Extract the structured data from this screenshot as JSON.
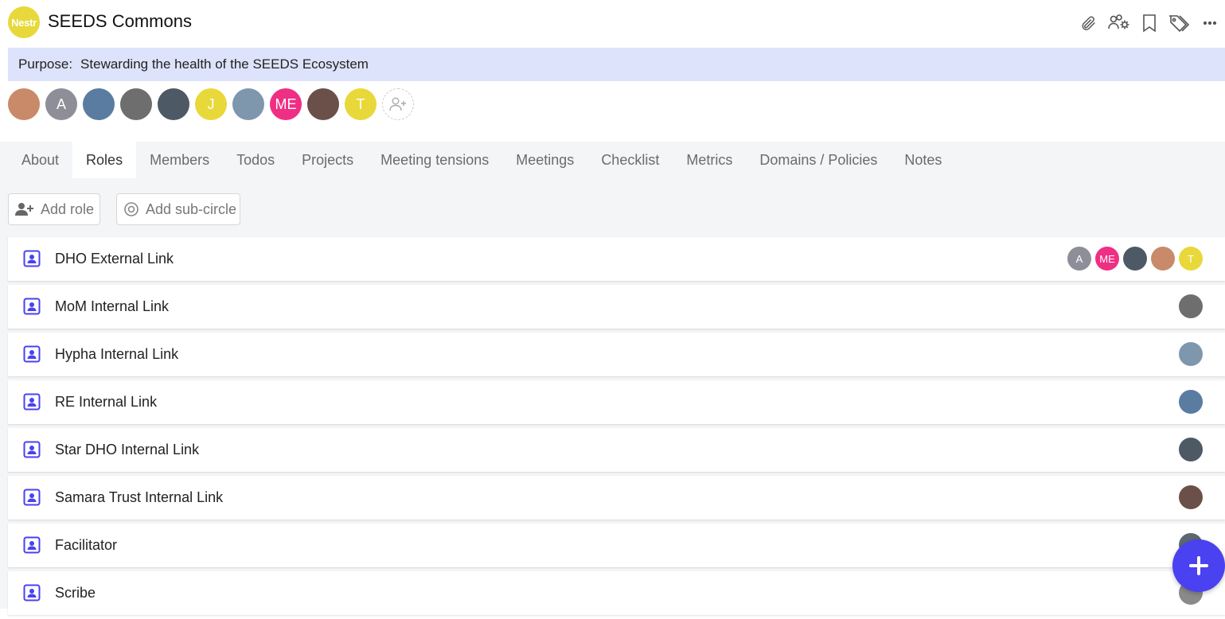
{
  "header": {
    "logo_text": "Nestr",
    "title": "SEEDS Commons"
  },
  "header_icons": [
    "paperclip-icon",
    "team-settings-icon",
    "bookmark-icon",
    "tags-icon",
    "more-icon"
  ],
  "purpose": {
    "label": "Purpose:",
    "text": "Stewarding the health of the SEEDS Ecosystem"
  },
  "members": [
    {
      "initial": "",
      "color": "#c98a6a"
    },
    {
      "initial": "A",
      "color": "#8e8e99"
    },
    {
      "initial": "",
      "color": "#5a7ca0"
    },
    {
      "initial": "",
      "color": "#6e6e6e"
    },
    {
      "initial": "",
      "color": "#4e5966"
    },
    {
      "initial": "J",
      "color": "#e8d83a"
    },
    {
      "initial": "",
      "color": "#7f97ad"
    },
    {
      "initial": "ME",
      "color": "#ef2f84"
    },
    {
      "initial": "",
      "color": "#6a5048"
    },
    {
      "initial": "T",
      "color": "#e8d83a"
    }
  ],
  "tabs": [
    "About",
    "Roles",
    "Members",
    "Todos",
    "Projects",
    "Meeting tensions",
    "Meetings",
    "Checklist",
    "Metrics",
    "Domains / Policies",
    "Notes"
  ],
  "actions": {
    "add_role": "Add role",
    "add_subcircle": "Add sub-circle"
  },
  "roles": [
    {
      "name": "DHO External Link",
      "assignees": [
        {
          "initial": "A",
          "color": "#8e8e99"
        },
        {
          "initial": "ME",
          "color": "#ef2f84"
        },
        {
          "initial": "",
          "color": "#4e5966"
        },
        {
          "initial": "",
          "color": "#c98a6a"
        },
        {
          "initial": "T",
          "color": "#e8d83a"
        }
      ]
    },
    {
      "name": "MoM Internal Link",
      "assignees": [
        {
          "initial": "",
          "color": "#6e6e6e"
        }
      ]
    },
    {
      "name": "Hypha Internal Link",
      "assignees": [
        {
          "initial": "",
          "color": "#7f97ad"
        }
      ]
    },
    {
      "name": "RE Internal Link",
      "assignees": [
        {
          "initial": "",
          "color": "#5a7ca0"
        }
      ]
    },
    {
      "name": "Star DHO Internal Link",
      "assignees": [
        {
          "initial": "",
          "color": "#4e5966"
        }
      ]
    },
    {
      "name": "Samara Trust Internal Link",
      "assignees": [
        {
          "initial": "",
          "color": "#6a5048"
        }
      ]
    },
    {
      "name": "Facilitator",
      "assignees": [
        {
          "initial": "",
          "color": "#5e6670"
        }
      ]
    },
    {
      "name": "Scribe",
      "assignees": [
        {
          "initial": "",
          "color": "#8a8a8a"
        }
      ]
    }
  ],
  "active_tab": "Roles",
  "colors": {
    "accent": "#4a41f0",
    "purpose_bg": "#dde3fb",
    "logo": "#e7d93b"
  }
}
